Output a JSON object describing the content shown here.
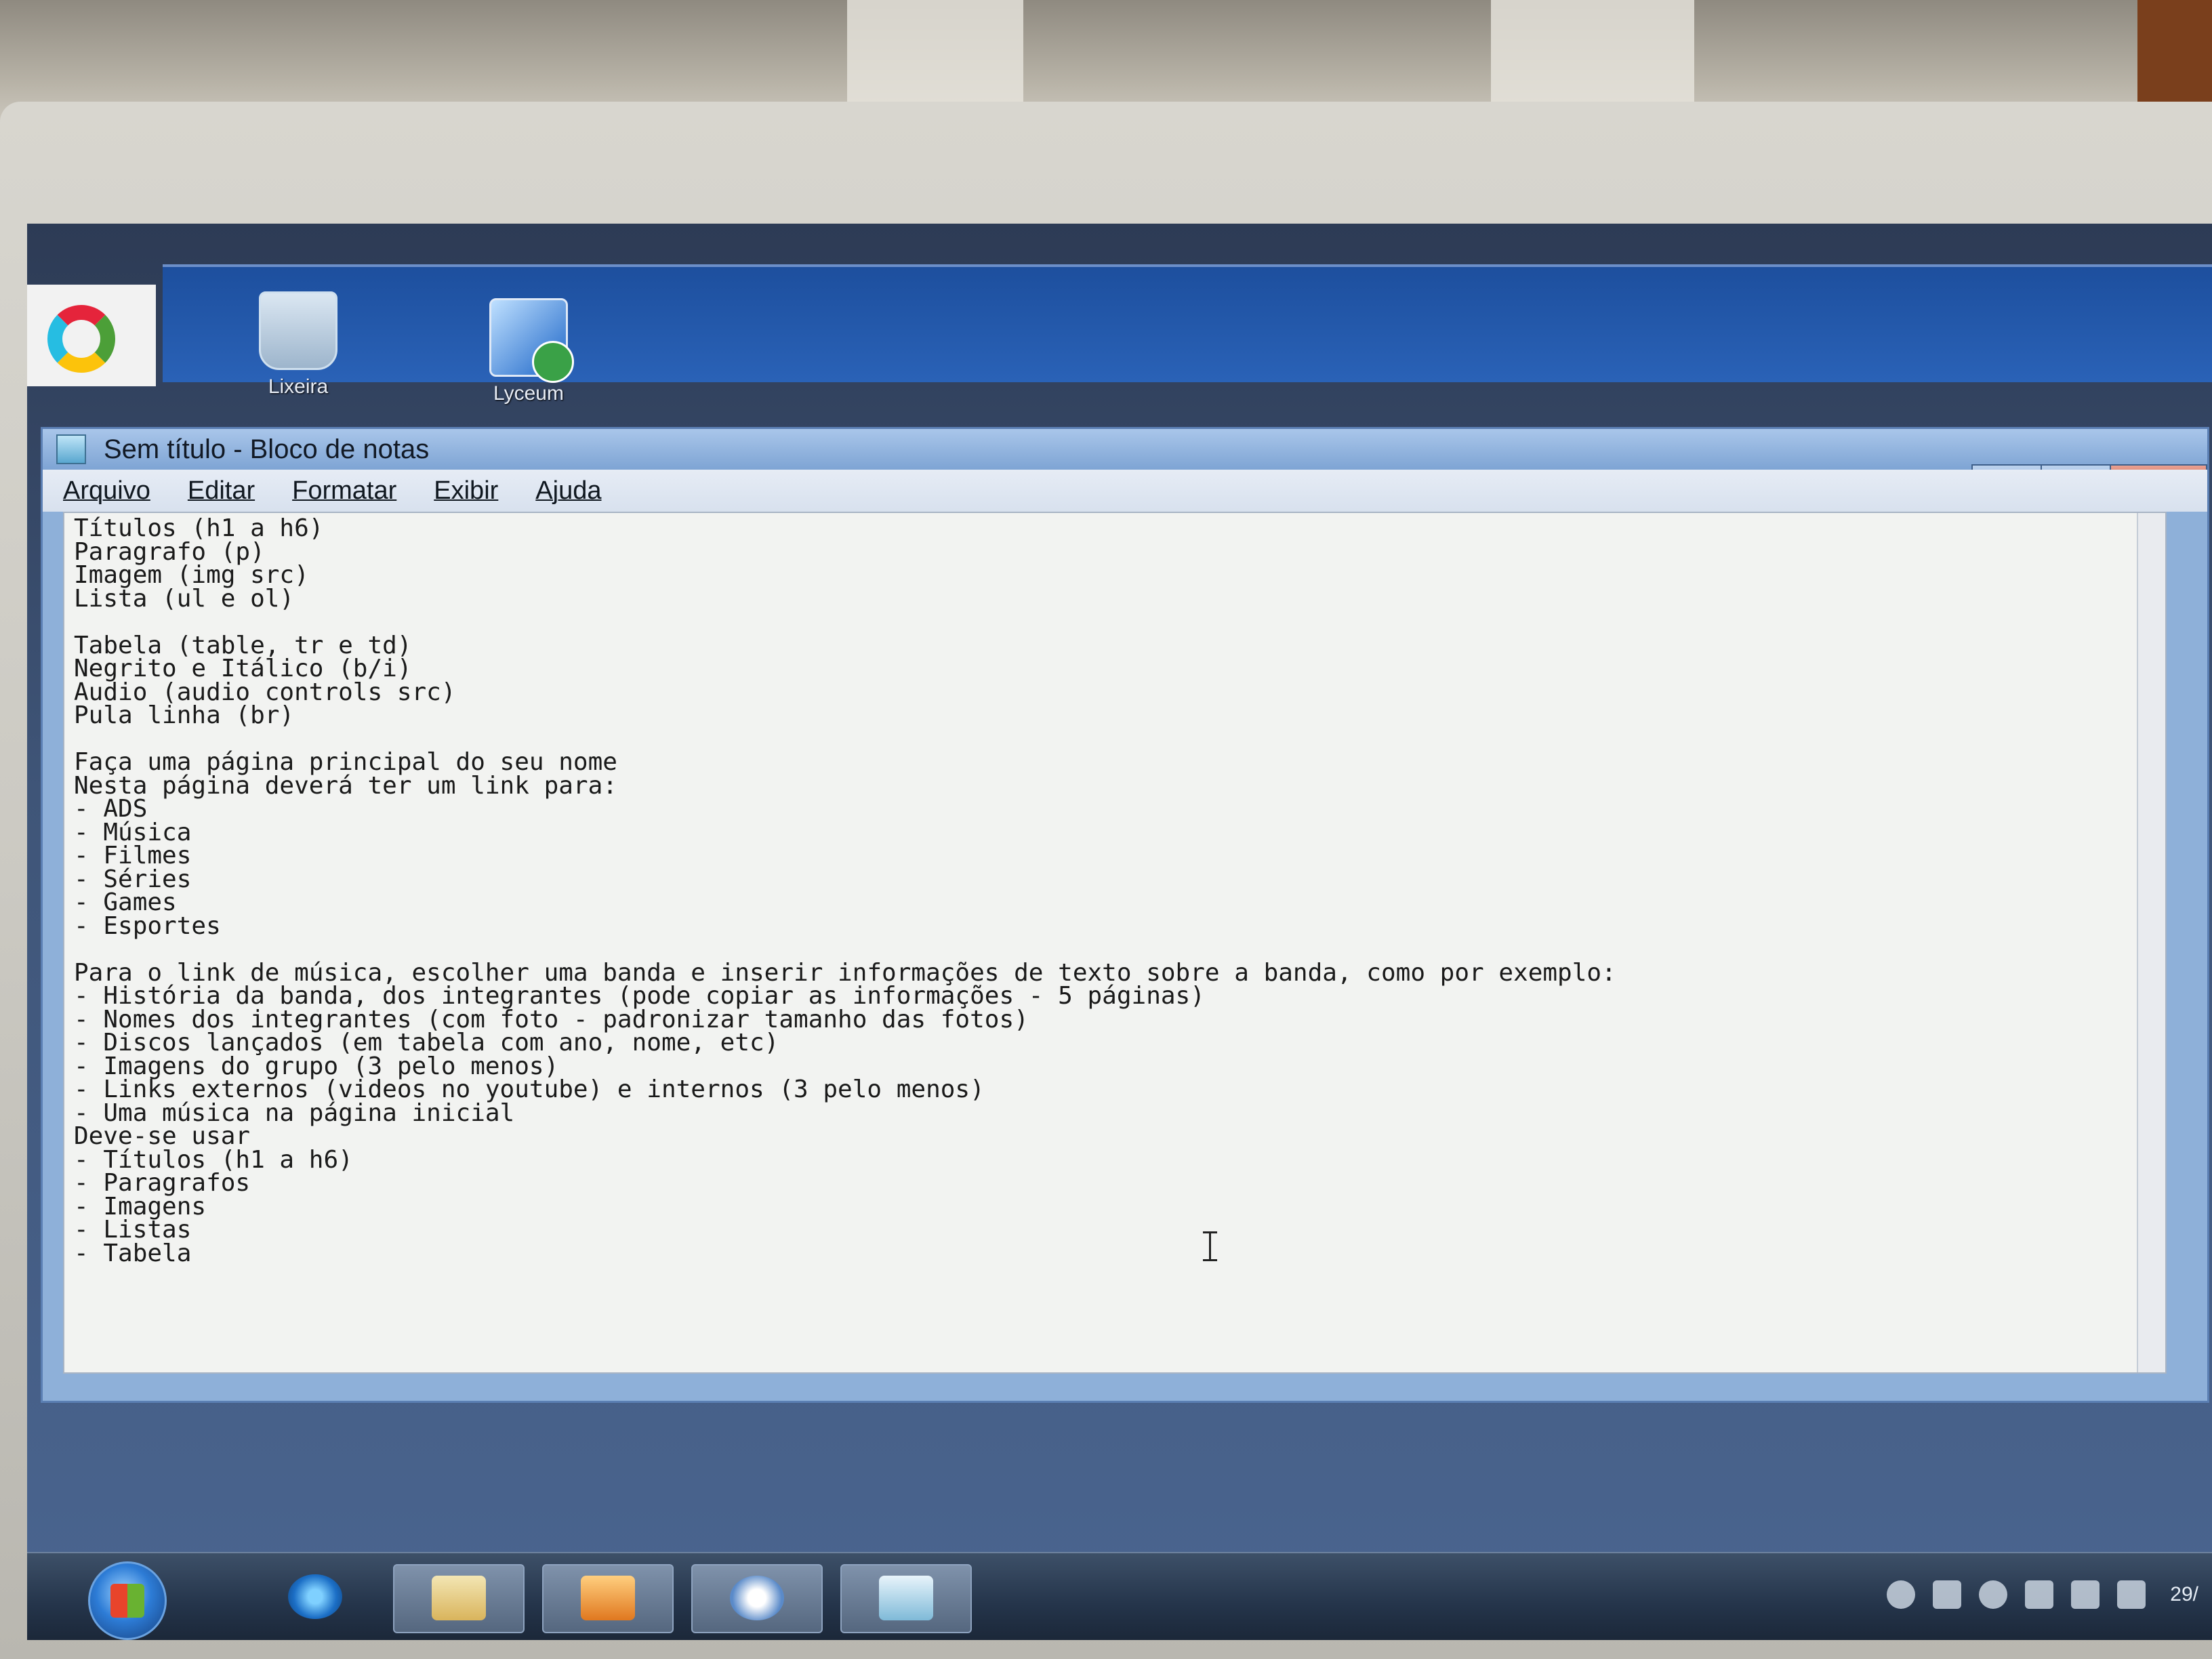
{
  "window": {
    "title": "Sem título - Bloco de notas"
  },
  "desktop": {
    "icons": [
      {
        "label": "Lixeira",
        "icon": "recycle-bin-icon"
      },
      {
        "label": "Lyceum",
        "icon": "remote-desktop-icon"
      }
    ]
  },
  "menu": {
    "items": [
      "Arquivo",
      "Editar",
      "Formatar",
      "Exibir",
      "Ajuda"
    ]
  },
  "editor": {
    "lines": [
      "Títulos (h1 a h6)",
      "Paragrafo (p)",
      "Imagem (img src)",
      "Lista (ul e ol)",
      "",
      "Tabela (table, tr e td)",
      "Negrito e Itálico (b/i)",
      "Audio (audio controls src)",
      "Pula linha (br)",
      "",
      "Faça uma página principal do seu nome",
      "Nesta página deverá ter um link para:",
      "- ADS",
      "- Música",
      "- Filmes",
      "- Séries",
      "- Games",
      "- Esportes",
      "",
      "Para o link de música, escolher uma banda e inserir informações de texto sobre a banda, como por exemplo:",
      "- História da banda, dos integrantes (pode copiar as informações - 5 páginas)",
      "- Nomes dos integrantes (com foto - padronizar tamanho das fotos)",
      "- Discos lançados (em tabela com ano, nome, etc)",
      "- Imagens do grupo (3 pelo menos)",
      "- Links externos (videos no youtube) e internos (3 pelo menos)",
      "- Uma música na página inicial",
      "Deve-se usar",
      "- Títulos (h1 a h6)",
      "- Paragrafos",
      "- Imagens",
      "- Listas",
      "- Tabela"
    ]
  },
  "window_controls": {
    "minimize": "—",
    "maximize": "□",
    "close": "X"
  },
  "taskbar": {
    "clock_partial": "29/"
  }
}
